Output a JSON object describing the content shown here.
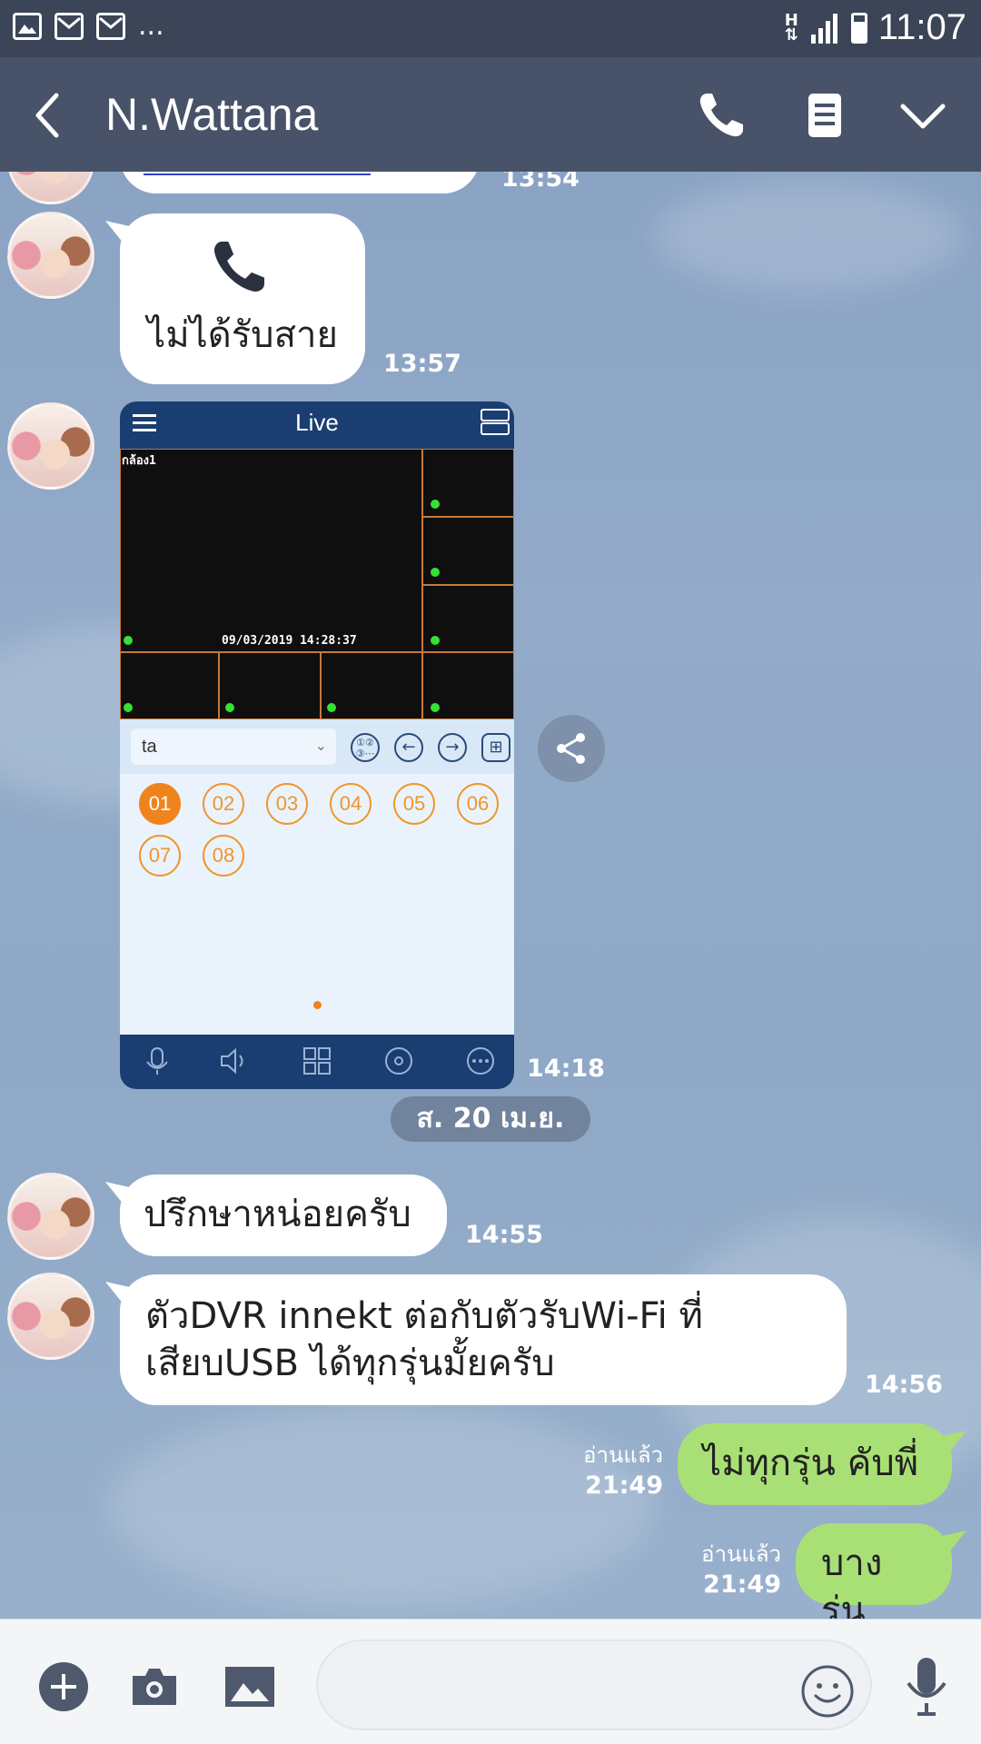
{
  "status_bar": {
    "time": "11:07",
    "network": "H",
    "left_icons": [
      "image-icon",
      "mail-icon",
      "mail-icon"
    ],
    "overflow": "..."
  },
  "header": {
    "title": "N.Wattana",
    "icons": [
      "back-icon",
      "phone-icon",
      "notes-icon",
      "chevron-down-icon"
    ]
  },
  "messages": [
    {
      "id": "prev",
      "from": "them",
      "partial": true,
      "time": "13:54"
    },
    {
      "id": "m1",
      "from": "them",
      "type": "call",
      "text": "ไม่ได้รับสาย",
      "time": "13:57"
    },
    {
      "id": "m2",
      "from": "them",
      "type": "image",
      "time": "14:18"
    },
    {
      "id": "m3",
      "from": "them",
      "text": "ปรึกษาหน่อยครับ",
      "time": "14:55"
    },
    {
      "id": "m4",
      "from": "them",
      "text_lines": [
        "ตัวDVR innekt ต่อกับตัวรับWi-Fi  ที่",
        "เสียบUSB ได้ทุกรุ่นมั้ยครับ"
      ],
      "time": "14:56"
    },
    {
      "id": "m5",
      "from": "me",
      "text": "ไม่ทุกรุ่น คับพี่",
      "read": "อ่านแล้ว",
      "time": "21:49"
    },
    {
      "id": "m6",
      "from": "me",
      "text": "บางรุ่น",
      "read": "อ่านแล้ว",
      "time": "21:49"
    }
  ],
  "date_separator": "ส. 20 เม.ย.",
  "screenshot": {
    "title": "Live",
    "camera_label": "กล้อง1",
    "timestamp": "09/03/2019 14:28:37",
    "selector_value": "ta",
    "channels": [
      "01",
      "02",
      "03",
      "04",
      "05",
      "06",
      "07",
      "08"
    ],
    "active_channel": "01"
  },
  "input": {
    "placeholder": "",
    "icons": [
      "plus-icon",
      "camera-icon",
      "image-icon",
      "emoji-icon",
      "microphone-icon"
    ]
  }
}
